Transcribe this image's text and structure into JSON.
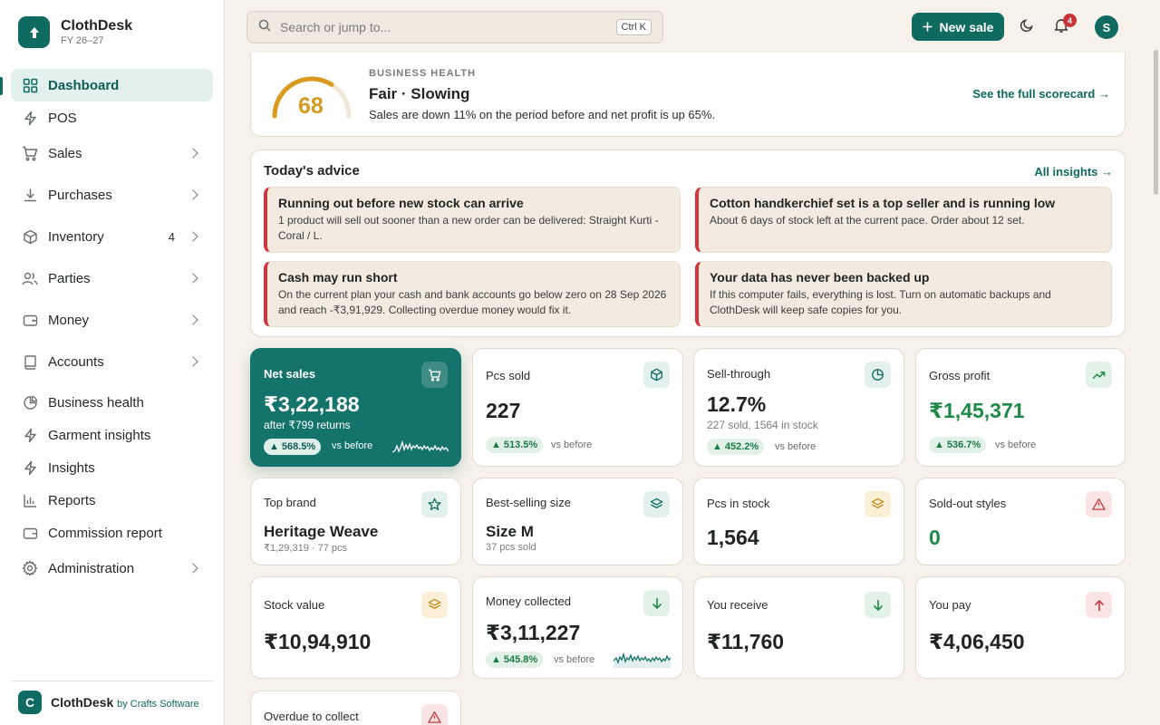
{
  "brand": {
    "name": "ClothDesk",
    "sub": "FY 26–27"
  },
  "nav": [
    {
      "label": "Dashboard",
      "icon": "grid-icon",
      "active": true
    },
    {
      "label": "POS",
      "icon": "bolt-icon"
    },
    {
      "label": "Sales",
      "icon": "cart-icon",
      "chevron": true
    },
    {
      "label": "Purchases",
      "icon": "download-icon",
      "chevron": true
    },
    {
      "label": "Inventory",
      "icon": "box-icon",
      "count": "4",
      "chevron": true
    },
    {
      "label": "Parties",
      "icon": "users-icon",
      "chevron": true
    },
    {
      "label": "Money",
      "icon": "wallet-icon",
      "chevron": true
    },
    {
      "label": "Accounts",
      "icon": "book-icon",
      "chevron": true
    },
    {
      "label": "Business health",
      "icon": "pie-icon"
    },
    {
      "label": "Garment insights",
      "icon": "bolt-icon"
    },
    {
      "label": "Insights",
      "icon": "bolt-icon"
    },
    {
      "label": "Reports",
      "icon": "bar-chart-icon"
    },
    {
      "label": "Commission report",
      "icon": "wallet-icon"
    },
    {
      "label": "Administration",
      "icon": "gear-icon",
      "chevron": true
    }
  ],
  "footer": {
    "letter": "C",
    "name": "ClothDesk",
    "by": "by Crafts Software"
  },
  "topbar": {
    "search_placeholder": "Search or jump to...",
    "shortcut": "Ctrl K",
    "new_sale": "New sale",
    "notifications": "4",
    "avatar": "S"
  },
  "health": {
    "score": "68",
    "kicker": "BUSINESS HEALTH",
    "title": "Fair · Slowing",
    "desc": "Sales are down 11% on the period before and net profit is up 65%.",
    "link": "See the full scorecard →",
    "score_fraction": 0.68
  },
  "advice": {
    "title": "Today's advice",
    "link": "All insights →",
    "tips": [
      {
        "title": "Running out before new stock can arrive",
        "body": "1 product will sell out sooner than a new order can be delivered: Straight Kurti - Coral / L."
      },
      {
        "title": "Cotton handkerchief set is a top seller and is running low",
        "body": "About 6 days of stock left at the current pace. Order about 12 set."
      },
      {
        "title": "Cash may run short",
        "body": "On the current plan your cash and bank accounts go below zero on 28 Sep 2026 and reach -₹3,91,929. Collecting overdue money would fix it."
      },
      {
        "title": "Your data has never been backed up",
        "body": "If this computer fails, everything is lost. Turn on automatic backups and ClothDesk will keep safe copies for you."
      }
    ]
  },
  "kpis": {
    "net_sales": {
      "label": "Net sales",
      "value": "₹3,22,188",
      "sub": "after ₹799 returns",
      "change": "568.5%",
      "vs": "vs before"
    },
    "pcs_sold": {
      "label": "Pcs sold",
      "value": "227",
      "change": "513.5%",
      "vs": "vs before"
    },
    "sell_through": {
      "label": "Sell-through",
      "value": "12.7%",
      "sub": "227 sold, 1564 in stock",
      "change": "452.2%",
      "vs": "vs before"
    },
    "gross_profit": {
      "label": "Gross profit",
      "value": "₹1,45,371",
      "change": "536.7%",
      "vs": "vs before"
    },
    "top_brand": {
      "label": "Top brand",
      "value": "Heritage Weave",
      "sub": "₹1,29,319 · 77 pcs"
    },
    "best_size": {
      "label": "Best-selling size",
      "value": "Size M",
      "sub": "37 pcs sold"
    },
    "pcs_stock": {
      "label": "Pcs in stock",
      "value": "1,564"
    },
    "sold_out": {
      "label": "Sold-out styles",
      "value": "0"
    },
    "stock_value": {
      "label": "Stock value",
      "value": "₹10,94,910"
    },
    "money_collected": {
      "label": "Money collected",
      "value": "₹3,11,227",
      "change": "545.8%",
      "vs": "vs before"
    },
    "you_receive": {
      "label": "You receive",
      "value": "₹11,760"
    },
    "you_pay": {
      "label": "You pay",
      "value": "₹4,06,450"
    },
    "overdue": {
      "label": "Overdue to collect"
    }
  }
}
